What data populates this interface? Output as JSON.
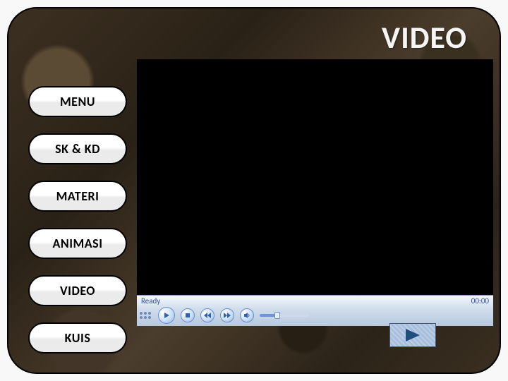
{
  "title": "VIDEO",
  "nav": {
    "items": [
      {
        "label": "MENU"
      },
      {
        "label": "SK & KD"
      },
      {
        "label": "MATERI"
      },
      {
        "label": "ANIMASI"
      },
      {
        "label": "VIDEO"
      },
      {
        "label": "KUIS"
      }
    ]
  },
  "player": {
    "status": "Ready",
    "time": "00:00",
    "volume_pct": 35
  },
  "next_button": {
    "label": ""
  }
}
